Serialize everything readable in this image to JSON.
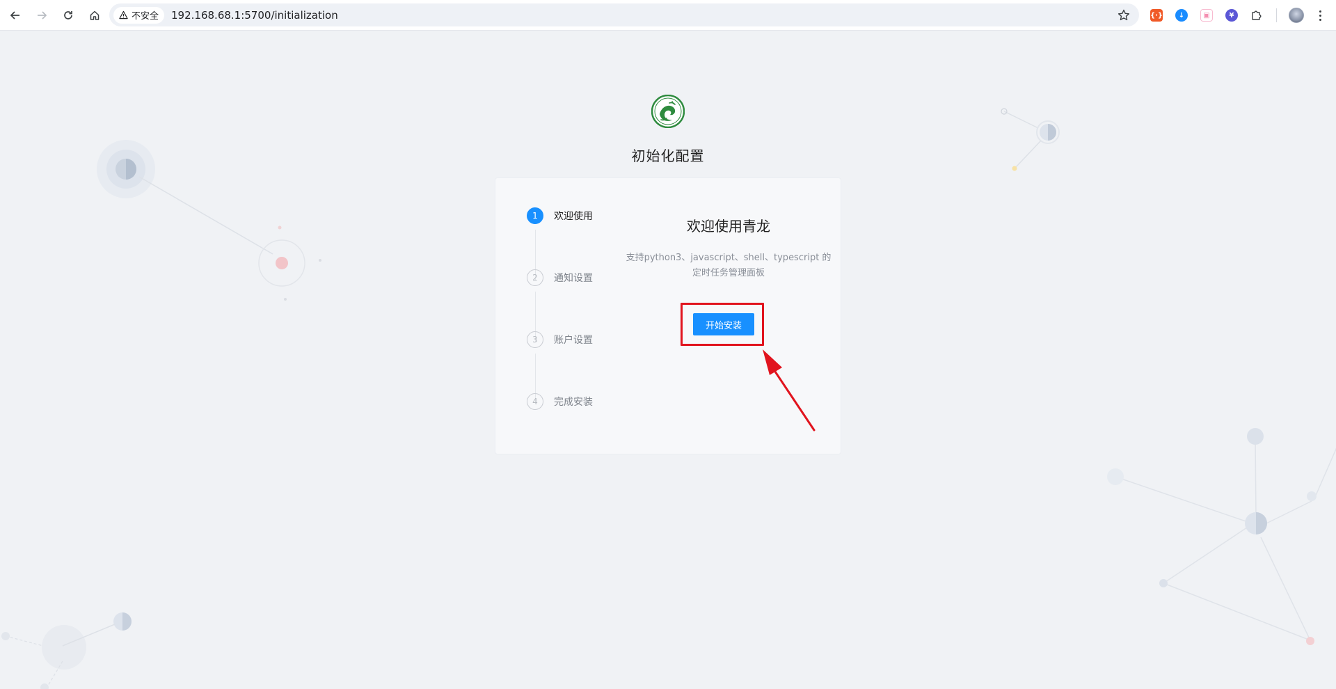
{
  "browser": {
    "security_label": "不安全",
    "url": "192.168.68.1:5700/initialization"
  },
  "page": {
    "title": "初始化配置"
  },
  "steps": [
    {
      "number": "1",
      "label": "欢迎使用",
      "state": "active"
    },
    {
      "number": "2",
      "label": "通知设置",
      "state": "wait"
    },
    {
      "number": "3",
      "label": "账户设置",
      "state": "wait"
    },
    {
      "number": "4",
      "label": "完成安装",
      "state": "wait"
    }
  ],
  "welcome": {
    "title": "欢迎使用青龙",
    "description_line1": "支持python3、javascript、shell、typescript 的",
    "description_line2": "定时任务管理面板",
    "start_button": "开始安装"
  },
  "colors": {
    "primary": "#1890ff",
    "annotation_red": "#e1141e",
    "logo_green": "#2e8b3e"
  }
}
